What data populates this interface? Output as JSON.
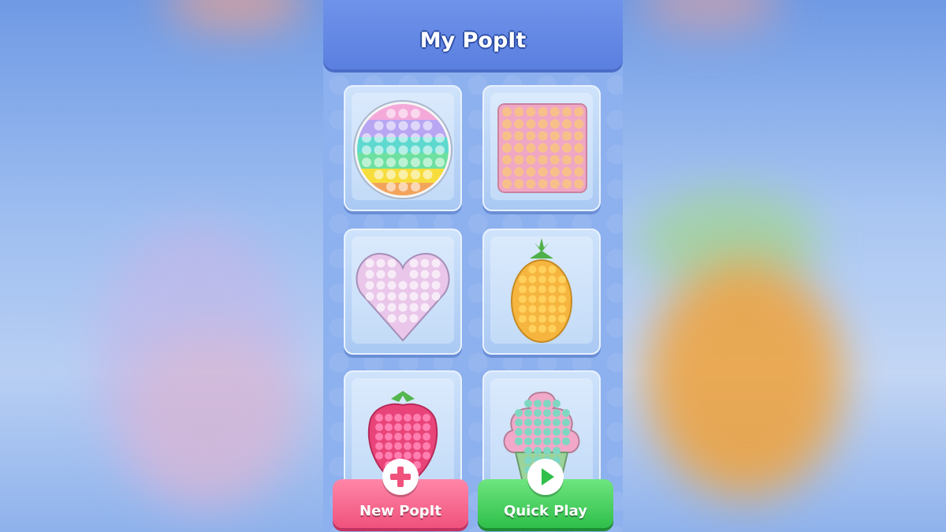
{
  "header": {
    "title": "My PopIt"
  },
  "cards": [
    {
      "name": "round-rainbow-popit"
    },
    {
      "name": "square-pink-popit"
    },
    {
      "name": "heart-pastel-popit"
    },
    {
      "name": "pineapple-popit"
    },
    {
      "name": "strawberry-popit"
    },
    {
      "name": "cupcake-popit"
    }
  ],
  "buttons": {
    "new_popit": {
      "label": "New PopIt",
      "icon": "plus-icon",
      "color": "#f0527c"
    },
    "quick_play": {
      "label": "Quick Play",
      "icon": "play-icon",
      "color": "#2fbf4a"
    }
  },
  "colors": {
    "header": "#5a7fe0",
    "background": "#8db0ee"
  }
}
